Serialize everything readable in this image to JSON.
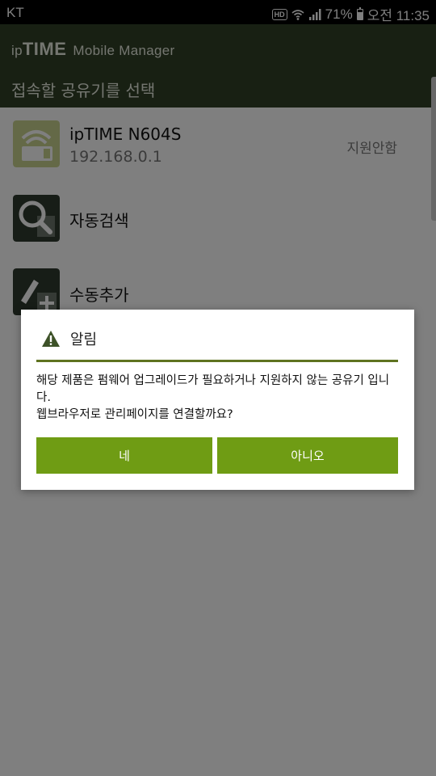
{
  "status_bar": {
    "carrier": "KT",
    "hd": "HD",
    "battery": "71%",
    "battery_level": 0.71,
    "time": "오전 11:35"
  },
  "header": {
    "brand_ip": "ip",
    "brand_time": "TIME",
    "brand_rest": "Mobile Manager",
    "subtitle": "접속할 공유기를 선택"
  },
  "list": {
    "items": [
      {
        "title": "ipTIME N604S",
        "subtitle": "192.168.0.1",
        "status": "지원안함",
        "icon": "router-wifi-icon"
      },
      {
        "title": "자동검색",
        "icon": "search-icon"
      },
      {
        "title": "수동추가",
        "icon": "pencil-add-icon"
      }
    ]
  },
  "dialog": {
    "title": "알림",
    "icon": "warning-icon",
    "message_line1": "해당 제품은 펌웨어 업그레이드가 필요하거나 지원하지 않는 공유기 입니다.",
    "message_line2": "웹브라우저로 관리페이지를 연결할까요?",
    "yes_label": "네",
    "no_label": "아니오"
  },
  "colors": {
    "header_bg": "#314127",
    "accent_green": "#6f9c14",
    "divider_green": "#5f7320"
  }
}
